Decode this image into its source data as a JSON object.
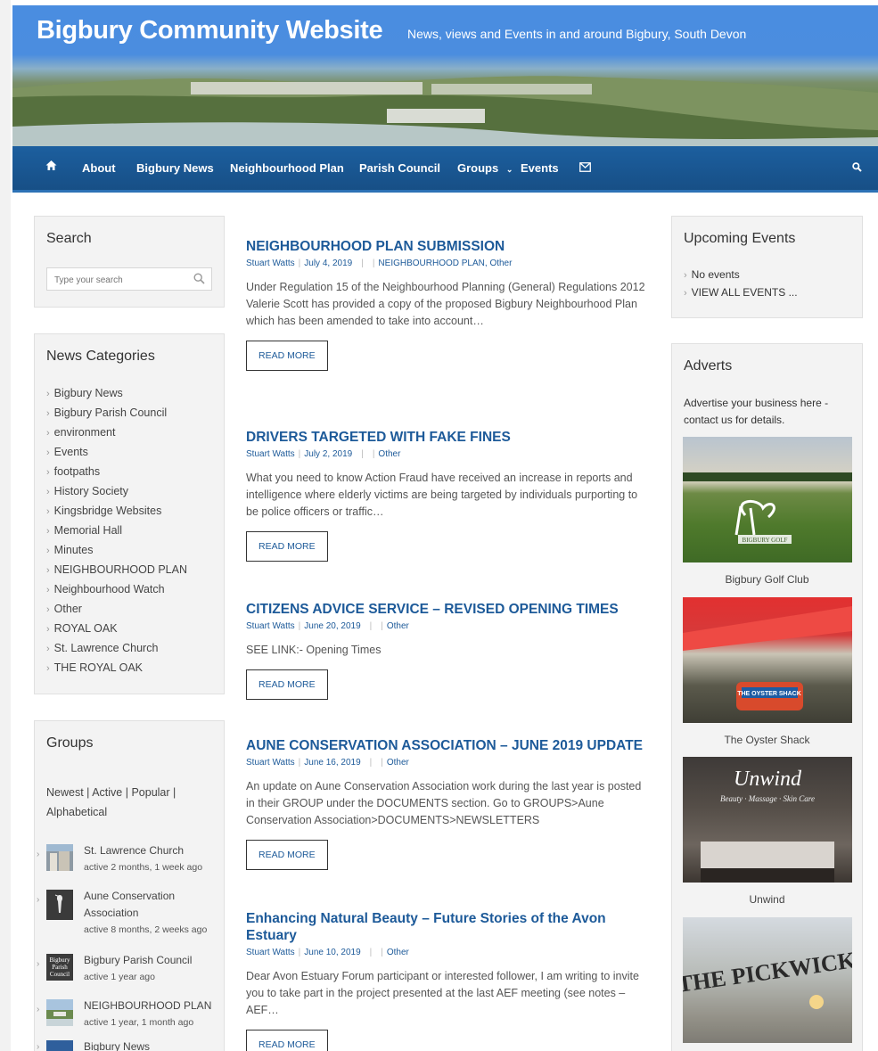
{
  "site": {
    "title": "Bigbury Community Website",
    "tagline": "News, views and Events in and around Bigbury, South Devon"
  },
  "nav": {
    "items": [
      "About",
      "Bigbury News",
      "Neighbourhood Plan",
      "Parish Council",
      "Groups",
      "Events"
    ]
  },
  "search_widget": {
    "title": "Search",
    "placeholder": "Type your search"
  },
  "news_categories": {
    "title": "News Categories",
    "items": [
      "Bigbury News",
      "Bigbury Parish Council",
      "environment",
      "Events",
      "footpaths",
      "History Society",
      "Kingsbridge Websites",
      "Memorial Hall",
      "Minutes",
      "NEIGHBOURHOOD PLAN",
      "Neighbourhood Watch",
      "Other",
      "ROYAL OAK",
      "St. Lawrence Church",
      "THE ROYAL OAK"
    ]
  },
  "groups": {
    "title": "Groups",
    "filters": [
      "Newest",
      "Active",
      "Popular",
      "Alphabetical"
    ],
    "items": [
      {
        "name": "St. Lawrence Church",
        "active": "active 2 months, 1 week ago"
      },
      {
        "name": "Aune Conservation Association",
        "active": "active 8 months, 2 weeks ago"
      },
      {
        "name": "Bigbury Parish Council",
        "active": "active 1 year ago",
        "thumb_text": "Bigbury Parish Council"
      },
      {
        "name": "NEIGHBOURHOOD PLAN",
        "active": "active 1 year, 1 month ago"
      },
      {
        "name": "Bigbury News",
        "active": ""
      }
    ]
  },
  "posts": [
    {
      "title": "NEIGHBOURHOOD PLAN SUBMISSION",
      "author": "Stuart Watts",
      "date": "July 4, 2019",
      "categories": "NEIGHBOURHOOD PLAN, Other",
      "excerpt": "Under Regulation 15 of the Neighbourhood Planning (General) Regulations 2012 Valerie Scott has provided a copy of the proposed Bigbury Neighbourhood Plan which has been amended to take into account…",
      "read_more": "READ MORE"
    },
    {
      "title": "DRIVERS TARGETED WITH FAKE FINES",
      "author": "Stuart Watts",
      "date": "July 2, 2019",
      "categories": "Other",
      "excerpt": "What you need to know Action Fraud have received an increase in reports and intelligence where elderly victims are being targeted by individuals purporting to be police officers or traffic…",
      "read_more": "READ MORE"
    },
    {
      "title": "CITIZENS ADVICE SERVICE – REVISED OPENING TIMES",
      "author": "Stuart Watts",
      "date": "June 20, 2019",
      "categories": "Other",
      "excerpt": "SEE LINK:- Opening Times",
      "read_more": "READ MORE"
    },
    {
      "title": "AUNE CONSERVATION ASSOCIATION – JUNE 2019 UPDATE",
      "author": "Stuart Watts",
      "date": "June 16, 2019",
      "categories": "Other",
      "excerpt": "An update on Aune Conservation Association work during the last year is posted in their GROUP under the DOCUMENTS section. Go to GROUPS>Aune Conservation Association>DOCUMENTS>NEWSLETTERS",
      "read_more": "READ MORE"
    },
    {
      "title": "Enhancing Natural Beauty – Future Stories of the Avon Estuary",
      "author": "Stuart Watts",
      "date": "June 10, 2019",
      "categories": "Other",
      "excerpt": "Dear Avon Estuary Forum participant or interested follower, I am writing to invite you to take part in the project presented at the last AEF meeting (see notes – AEF…",
      "read_more": "READ MORE"
    }
  ],
  "upcoming_events": {
    "title": "Upcoming Events",
    "items": [
      "No events",
      "VIEW ALL EVENTS ..."
    ]
  },
  "adverts": {
    "title": "Adverts",
    "intro": "Advertise your business here - contact us for details.",
    "items": [
      {
        "name": "Bigbury Golf Club",
        "logo_text": "BIGBURY GOLF"
      },
      {
        "name": "The Oyster Shack",
        "logo_text": "THE OYSTER SHACK"
      },
      {
        "name": "Unwind",
        "logo_text": "Unwind",
        "logo_sub": "Beauty · Massage · Skin Care"
      },
      {
        "name": "",
        "logo_text": "THE PICKWICK"
      }
    ]
  },
  "colors": {
    "header_blue": "#4a8de0",
    "nav_blue": "#1c5f9f",
    "link_blue": "#1d5a99"
  }
}
